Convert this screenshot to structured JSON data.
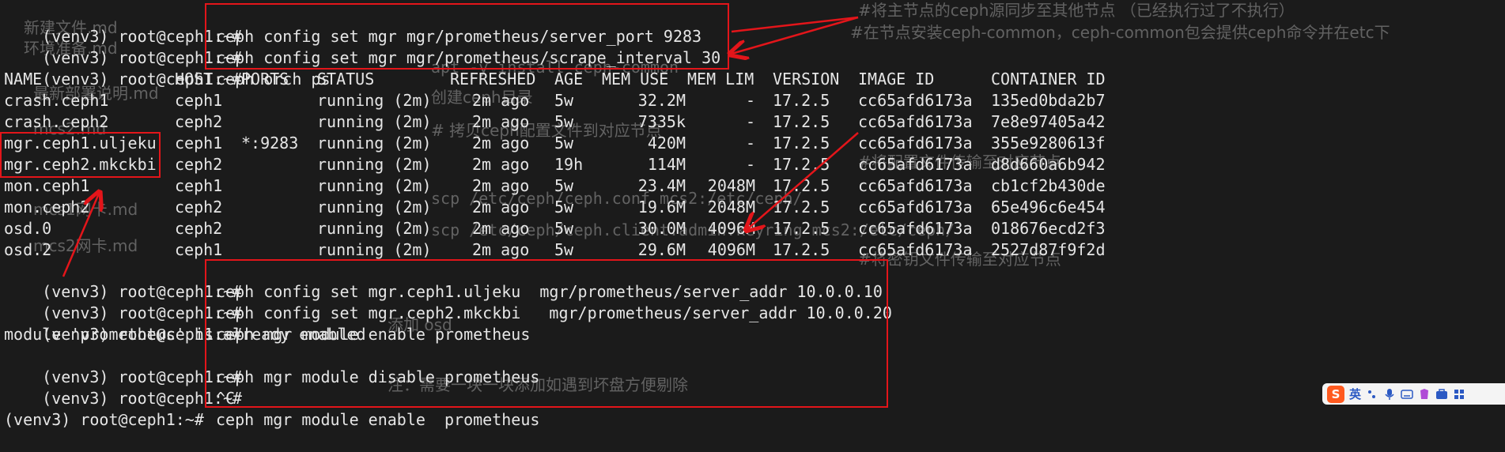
{
  "colors": {
    "background": "#1b1b1b",
    "text": "#e6e6e6",
    "ghost_text": "#6f6f6f",
    "highlight": "#e3151a"
  },
  "terminal": {
    "prompt": "(venv3) root@ceph1:~#",
    "top_commands": [
      "ceph config set mgr mgr/prometheus/server_port 9283",
      "ceph config set mgr mgr/prometheus/scrape_interval 30",
      "ceph orch ps"
    ],
    "ps_table": {
      "headers": [
        "NAME",
        "HOST",
        "PORTS",
        "STATUS",
        "REFRESHED",
        "AGE",
        "MEM USE",
        "MEM LIM",
        "VERSION",
        "IMAGE ID",
        "CONTAINER ID"
      ],
      "rows": [
        [
          "crash.ceph1",
          "ceph1",
          "",
          "running (2m)",
          "2m ago",
          "5w",
          "32.2M",
          "-",
          "17.2.5",
          "cc65afd6173a",
          "135ed0bda2b7"
        ],
        [
          "crash.ceph2",
          "ceph2",
          "",
          "running (2m)",
          "2m ago",
          "5w",
          "7335k",
          "-",
          "17.2.5",
          "cc65afd6173a",
          "7e8e97405a42"
        ],
        [
          "mgr.ceph1.uljeku",
          "ceph1",
          "*:9283",
          "running (2m)",
          "2m ago",
          "5w",
          "420M",
          "-",
          "17.2.5",
          "cc65afd6173a",
          "355e9280613f"
        ],
        [
          "mgr.ceph2.mkckbi",
          "ceph2",
          "",
          "running (2m)",
          "2m ago",
          "19h",
          "114M",
          "-",
          "17.2.5",
          "cc65afd6173a",
          "d8d660a6b942"
        ],
        [
          "mon.ceph1",
          "ceph1",
          "",
          "running (2m)",
          "2m ago",
          "5w",
          "23.4M",
          "2048M",
          "17.2.5",
          "cc65afd6173a",
          "cb1cf2b430de"
        ],
        [
          "mon.ceph2",
          "ceph2",
          "",
          "running (2m)",
          "2m ago",
          "5w",
          "19.6M",
          "2048M",
          "17.2.5",
          "cc65afd6173a",
          "65e496c6e454"
        ],
        [
          "osd.0",
          "ceph2",
          "",
          "running (2m)",
          "2m ago",
          "5w",
          "30.0M",
          "4096M",
          "17.2.5",
          "cc65afd6173a",
          "018676ecd2f3"
        ],
        [
          "osd.2",
          "ceph1",
          "",
          "running (2m)",
          "2m ago",
          "5w",
          "29.6M",
          "4096M",
          "17.2.5",
          "cc65afd6173a",
          "2527d87f9f2d"
        ]
      ]
    },
    "bottom_commands": [
      "ceph config set mgr.ceph1.uljeku  mgr/prometheus/server_addr 10.0.0.10",
      "ceph config set mgr.ceph2.mkckbi   mgr/prometheus/server_addr 10.0.0.20",
      "ceph mgr module enable prometheus"
    ],
    "module_msg": "module 'prometheus' is already enabled",
    "disable_cmd": "ceph mgr module disable prometheus",
    "ctrl_c": "^C",
    "enable_cmd": "ceph mgr module enable  prometheus",
    "partial_last": "(venv3) root@ceph1:~#"
  },
  "background_doc": {
    "file_items": [
      "新建文件.md",
      "环境准备.md",
      "最新部署说明.md",
      "mcs2.md",
      "mcs1网卡.md",
      "mcs2网卡.md"
    ],
    "lines": [
      "#将主节点的ceph源同步至其他节点 （已经执行过了不执行）",
      "#在节点安装ceph-common，ceph-common包会提供ceph命令并在etc下",
      "创建ceph目录",
      "# 拷贝ceph配置文件到对应节点",
      "#将配置文件传输至对应节点",
      "#将密钥文件传输至对应节点",
      "添加 osd",
      "注：需要一块一块添加如遇到坏盘方便剔除"
    ],
    "code": [
      "apt -y install ceph-common",
      "scp /etc/ceph/ceph.conf mcs2:/etc/ceph/",
      "scp /etc/ceph/ceph.client.admin.keyring mcs2:/etc/ceph/"
    ]
  },
  "ime": {
    "lang": "英",
    "icons": [
      "punctuation-icon",
      "microphone-icon",
      "keyboard-icon",
      "skin-icon",
      "toolbox-icon",
      "menu-icon"
    ]
  }
}
